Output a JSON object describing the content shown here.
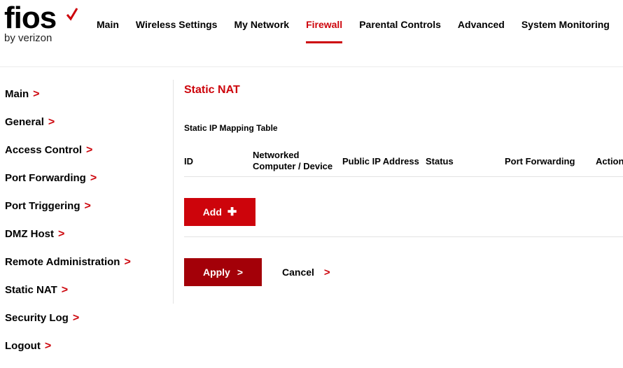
{
  "brand": {
    "name": "fios",
    "tagline": "by verizon",
    "accent_color": "#cd040b"
  },
  "topnav": {
    "items": [
      {
        "label": "Main"
      },
      {
        "label": "Wireless Settings"
      },
      {
        "label": "My Network"
      },
      {
        "label": "Firewall",
        "active": true
      },
      {
        "label": "Parental Controls"
      },
      {
        "label": "Advanced"
      },
      {
        "label": "System Monitoring"
      }
    ]
  },
  "sidebar": {
    "items": [
      {
        "label": "Main"
      },
      {
        "label": "General"
      },
      {
        "label": "Access Control"
      },
      {
        "label": "Port Forwarding"
      },
      {
        "label": "Port Triggering"
      },
      {
        "label": "DMZ Host"
      },
      {
        "label": "Remote Administration"
      },
      {
        "label": "Static NAT"
      },
      {
        "label": "Security Log"
      },
      {
        "label": "Logout"
      }
    ],
    "chevron_icon": "chevron-right-icon"
  },
  "main": {
    "title": "Static NAT",
    "table_title": "Static IP Mapping Table",
    "columns": {
      "id": "ID",
      "computer_line1": "Networked",
      "computer_line2": "Computer / Device",
      "public_ip": "Public IP Address",
      "status": "Status",
      "port_forwarding": "Port Forwarding",
      "action": "Action"
    },
    "rows": [],
    "add_label": "Add",
    "add_icon": "plus-icon",
    "apply_label": "Apply",
    "cancel_label": "Cancel"
  }
}
